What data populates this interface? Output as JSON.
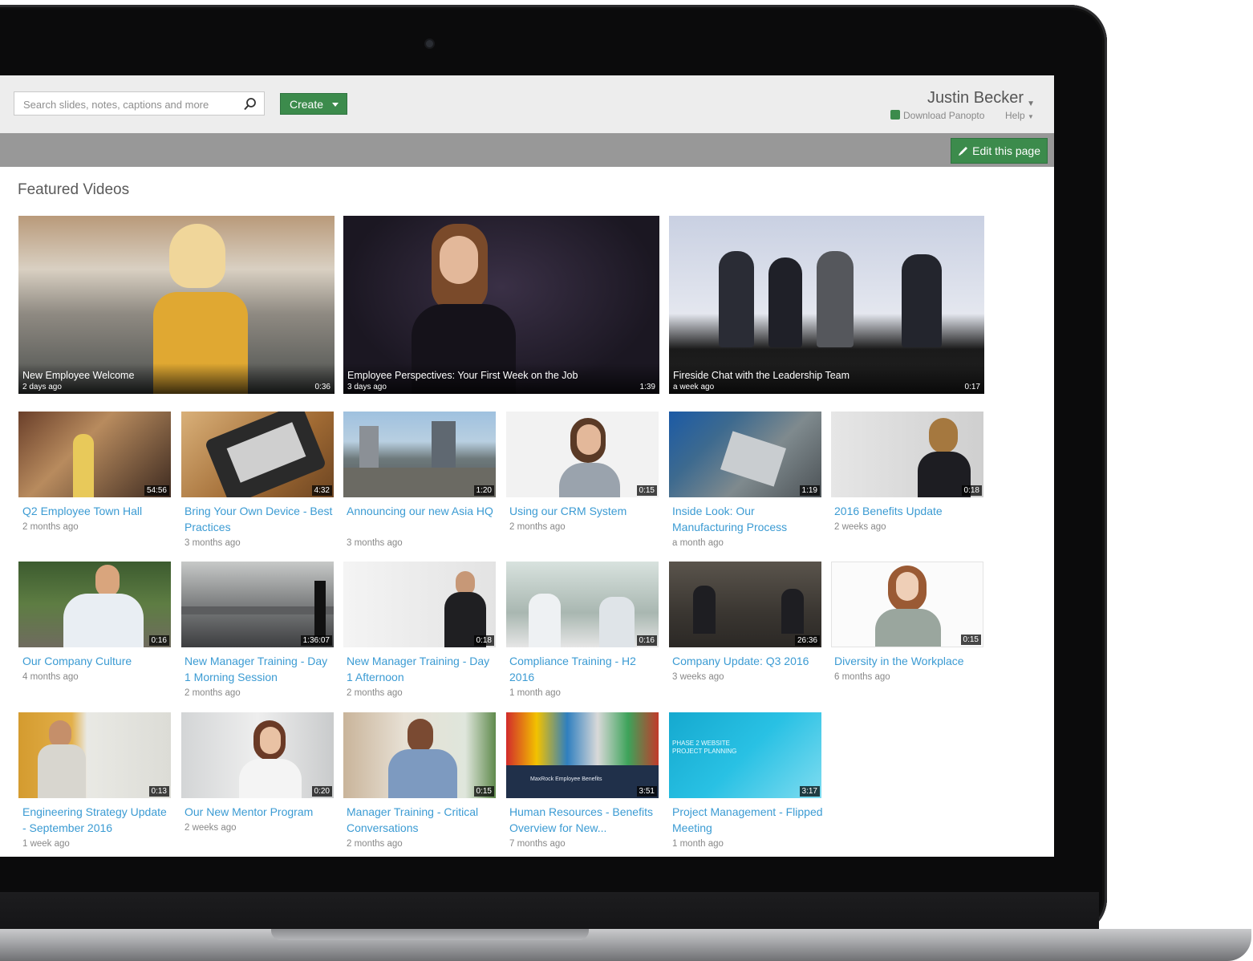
{
  "colors": {
    "accent_green": "#3c8b4c",
    "link_blue": "#3b9bd3",
    "header_gray": "#989898"
  },
  "header": {
    "search": {
      "placeholder": "Search slides, notes, captions and more",
      "icon": "search-icon"
    },
    "create_label": "Create",
    "user_name": "Justin Becker",
    "download_label": "Download Panopto",
    "help_label": "Help"
  },
  "toolbar": {
    "edit_label": "Edit this page",
    "edit_icon": "pencil-icon"
  },
  "section_title": "Featured Videos",
  "featured": [
    {
      "title": "New Employee Welcome",
      "age": "2 days ago",
      "duration": "0:36"
    },
    {
      "title": "Employee Perspectives: Your First Week on the Job",
      "age": "3 days ago",
      "duration": "1:39"
    },
    {
      "title": "Fireside Chat with the Leadership Team",
      "age": "a week ago",
      "duration": "0:17"
    }
  ],
  "videos": [
    {
      "title": "Q2 Employee Town Hall",
      "age": "2 months ago",
      "duration": "54:56"
    },
    {
      "title": "Bring Your Own Device - Best Practices",
      "age": "3 months ago",
      "duration": "4:32"
    },
    {
      "title": "Announcing our new Asia HQ",
      "age": "3 months ago",
      "duration": "1:20"
    },
    {
      "title": "Using our CRM System",
      "age": "2 months ago",
      "duration": "0:15"
    },
    {
      "title": "Inside Look: Our Manufacturing Process",
      "age": "a month ago",
      "duration": "1:19"
    },
    {
      "title": "2016 Benefits Update",
      "age": "2 weeks ago",
      "duration": "0:18"
    },
    {
      "title": "Our Company Culture",
      "age": "4 months ago",
      "duration": "0:16"
    },
    {
      "title": "New Manager Training - Day 1 Morning Session",
      "age": "2 months ago",
      "duration": "1:36:07"
    },
    {
      "title": "New Manager Training - Day 1 Afternoon",
      "age": "2 months ago",
      "duration": "0:18"
    },
    {
      "title": "Compliance Training - H2 2016",
      "age": "1 month ago",
      "duration": "0:16"
    },
    {
      "title": "Company Update: Q3 2016",
      "age": "3 weeks ago",
      "duration": "26:36"
    },
    {
      "title": "Diversity in the Workplace",
      "age": "6 months ago",
      "duration": "0:15"
    },
    {
      "title": "Engineering Strategy Update - September 2016",
      "age": "1 week ago",
      "duration": "0:13"
    },
    {
      "title": "Our New Mentor Program",
      "age": "2 weeks ago",
      "duration": "0:20"
    },
    {
      "title": "Manager Training - Critical Conversations",
      "age": "2 months ago",
      "duration": "0:15"
    },
    {
      "title": "Human Resources - Benefits Overview for New...",
      "age": "7 months ago",
      "duration": "3:51"
    },
    {
      "title": "Project Management - Flipped Meeting",
      "age": "1 month ago",
      "duration": "3:17"
    }
  ],
  "thumbnail_text": {
    "hr_slide": "MaxRock Employee Benefits",
    "pm_slide": "PHASE 2 WEBSITE PROJECT PLANNING"
  }
}
